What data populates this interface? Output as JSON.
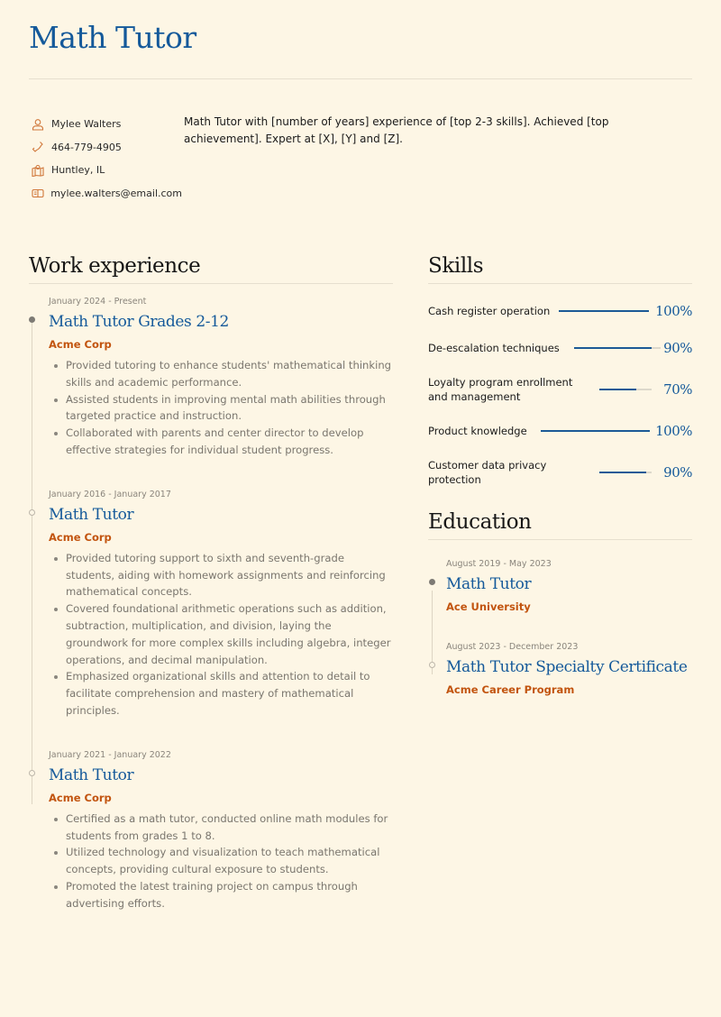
{
  "header": {
    "name": "Math Tutor"
  },
  "contact": {
    "items": [
      {
        "icon": "user-icon",
        "text": "Mylee Walters"
      },
      {
        "icon": "phone-icon",
        "text": "464-779-4905"
      },
      {
        "icon": "map-icon",
        "text": "Huntley, IL"
      },
      {
        "icon": "mail-icon",
        "text": "mylee.walters@email.com"
      }
    ]
  },
  "summary": "Math Tutor with [number of years] experience of [top 2-3 skills]. Achieved [top achievement]. Expert at [X], [Y] and [Z].",
  "work": {
    "title": "Work experience",
    "jobs": [
      {
        "date": "January 2024 - Present",
        "title": "Math Tutor Grades 2-12",
        "company": "Acme Corp",
        "bullets": [
          "Provided tutoring to enhance students' mathematical thinking skills and academic performance.",
          "Assisted students in improving mental math abilities through targeted practice and instruction.",
          "Collaborated with parents and center director to develop effective strategies for individual student progress."
        ]
      },
      {
        "date": "January 2016 - January 2017",
        "title": "Math Tutor",
        "company": "Acme Corp",
        "bullets": [
          "Provided tutoring support to sixth and seventh-grade students, aiding with homework assignments and reinforcing mathematical concepts.",
          "Covered foundational arithmetic operations such as addition, subtraction, multiplication, and division, laying the groundwork for more complex skills including algebra, integer operations, and decimal manipulation.",
          "Emphasized organizational skills and attention to detail to facilitate comprehension and mastery of mathematical principles."
        ]
      },
      {
        "date": "January 2021 - January 2022",
        "title": "Math Tutor",
        "company": "Acme Corp",
        "bullets": [
          "Certified as a math tutor, conducted online math modules for students from grades 1 to 8.",
          "Utilized technology and visualization to teach mathematical concepts, providing cultural exposure to students.",
          "Promoted the latest training project on campus through advertising efforts."
        ]
      }
    ]
  },
  "skills": {
    "title": "Skills",
    "items": [
      {
        "label": "Cash register operation",
        "level": 100,
        "display": "100%"
      },
      {
        "label": "De-escalation techniques",
        "level": 90,
        "display": "90%"
      },
      {
        "label": "Loyalty program enrollment and management",
        "level": 70,
        "display": "70%"
      },
      {
        "label": "Product knowledge",
        "level": 100,
        "display": "100%"
      },
      {
        "label": "Customer data privacy protection",
        "level": 90,
        "display": "90%"
      }
    ]
  },
  "education": {
    "title": "Education",
    "items": [
      {
        "date": "August 2019 - May 2023",
        "title": "Math Tutor",
        "school": "Ace University"
      },
      {
        "date": "August 2023 - December 2023",
        "title": "Math Tutor Specialty Certificate",
        "school": "Acme Career Program"
      }
    ]
  },
  "colors": {
    "accent": "#14599a",
    "company": "#c2540f",
    "background": "#fdf6e5",
    "icon": "#d0773a"
  }
}
